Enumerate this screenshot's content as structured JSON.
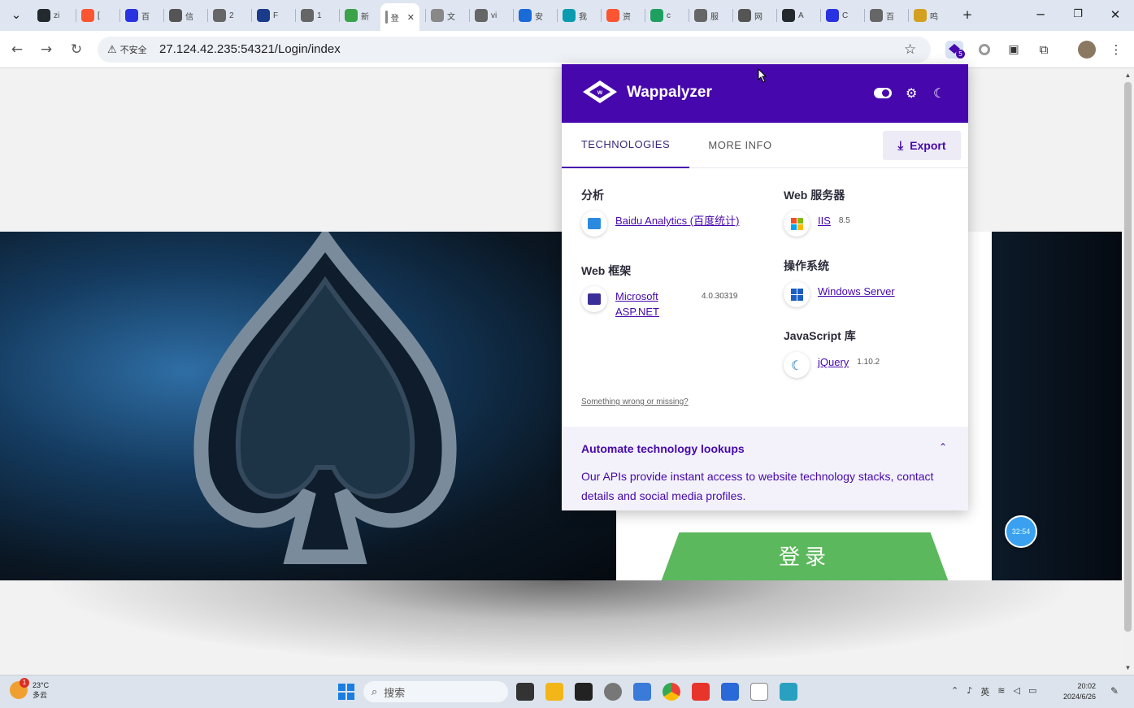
{
  "browser": {
    "tabs": [
      {
        "label": "zi",
        "icon": "github-icon",
        "color": "#24292e"
      },
      {
        "label": "[",
        "icon": "csdn-icon",
        "color": "#fc5531"
      },
      {
        "label": "百",
        "icon": "baidu-icon",
        "color": "#2932e1"
      },
      {
        "label": "信",
        "icon": "wechat-icon",
        "color": "#555555"
      },
      {
        "label": "2",
        "icon": "globe-icon",
        "color": "#666666"
      },
      {
        "label": "F",
        "icon": "fofa-icon",
        "color": "#1a3a8a"
      },
      {
        "label": "1",
        "icon": "globe-icon",
        "color": "#666666"
      },
      {
        "label": "新",
        "icon": "leaf-icon",
        "color": "#3aa34a"
      },
      {
        "label": "登",
        "icon": "page-icon",
        "color": "#888888",
        "active": true
      },
      {
        "label": "文",
        "icon": "page-icon",
        "color": "#888888"
      },
      {
        "label": "vi",
        "icon": "globe-icon",
        "color": "#666666"
      },
      {
        "label": "安",
        "icon": "shield-icon",
        "color": "#1a6ad8"
      },
      {
        "label": "我",
        "icon": "n-icon",
        "color": "#0a9bb0"
      },
      {
        "label": "资",
        "icon": "csdn-icon",
        "color": "#fc5531"
      },
      {
        "label": "c",
        "icon": "s-icon",
        "color": "#20a060"
      },
      {
        "label": "服",
        "icon": "globe-icon",
        "color": "#666666"
      },
      {
        "label": "网",
        "icon": "link-icon",
        "color": "#555555"
      },
      {
        "label": "A",
        "icon": "github-icon",
        "color": "#24292e"
      },
      {
        "label": "C",
        "icon": "baidu-icon",
        "color": "#2932e1"
      },
      {
        "label": "百",
        "icon": "globe-icon",
        "color": "#666666"
      },
      {
        "label": "鸣",
        "icon": "py-icon",
        "color": "#d4a020"
      }
    ],
    "close_glyph": "✕",
    "new_tab_glyph": "+",
    "insecure_label": "不安全",
    "url": "27.124.42.235:54321/Login/index",
    "extension_badge": "5"
  },
  "page": {
    "login_label": "登录",
    "timer": "32:54"
  },
  "wappalyzer": {
    "brand": "Wappalyzer",
    "tabs": {
      "technologies": "TECHNOLOGIES",
      "more_info": "MORE INFO"
    },
    "export_label": "Export",
    "categories": {
      "analytics": {
        "title": "分析",
        "items": [
          {
            "name": "Baidu Analytics (百度统计)",
            "version": ""
          }
        ]
      },
      "web_framework": {
        "title": "Web 框架",
        "items": [
          {
            "name": "Microsoft ASP.NET",
            "version": "4.0.30319"
          }
        ]
      },
      "web_server": {
        "title": "Web 服务器",
        "items": [
          {
            "name": "IIS",
            "version": "8.5"
          }
        ]
      },
      "os": {
        "title": "操作系统",
        "items": [
          {
            "name": "Windows Server",
            "version": ""
          }
        ]
      },
      "js_library": {
        "title": "JavaScript 库",
        "items": [
          {
            "name": "jQuery",
            "version": "1.10.2"
          }
        ]
      }
    },
    "missing_link": "Something wrong or missing?",
    "automate": {
      "title": "Automate technology lookups",
      "text": "Our APIs provide instant access to website technology stacks, contact details and social media profiles."
    },
    "colors": {
      "header": "#4608ad",
      "accent": "#4608ad"
    }
  },
  "taskbar": {
    "weather_badge": "1",
    "temperature": "23°C",
    "condition": "多云",
    "search_placeholder": "搜索",
    "input_method": "英",
    "time": "20:02",
    "date": "2024/6/26"
  }
}
